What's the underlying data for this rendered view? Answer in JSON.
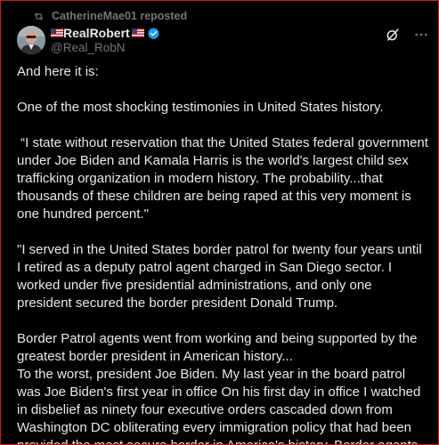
{
  "repost": {
    "text": "CatherineMae01 reposted",
    "icon": "repost-icon"
  },
  "author": {
    "name": "RealRobert",
    "handle": "@Real_RobN",
    "verified": true,
    "flag_icon": "us-flag-icon"
  },
  "colors": {
    "background": "#000000",
    "text": "#e7e9ea",
    "muted": "#71767b",
    "verified_blue": "#1d9bf0",
    "frame_border": "#cc1a1a"
  },
  "post": {
    "p1": "And here it is:",
    "p2": "One of the most shocking testimonies in United States history.",
    "p3": " “I state without reservation that the United States federal government under Joe Biden and Kamala Harris is the world's largest child sex trafficking organization in modern history. The probability...that thousands of these children are being raped at this very moment is one hundred percent.\"",
    "p4": "\"I served in the United States border patrol for twenty four years until I retired as a deputy patrol agent charged in San Diego sector. I worked under five presidential administrations, and only one president secured the border president Donald Trump.",
    "p5": "Border Patrol agents went from working and being supported by the greatest border president in American history...",
    "p6": "To the worst, president Joe Biden. My last year in the board patrol was Joe Biden's first year in office On his first day in office I watched in disbelief as ninety four executive orders cascaded down from Washington DC obliterating every immigration policy that had been provided the most secure border in America's history. Border agents"
  }
}
